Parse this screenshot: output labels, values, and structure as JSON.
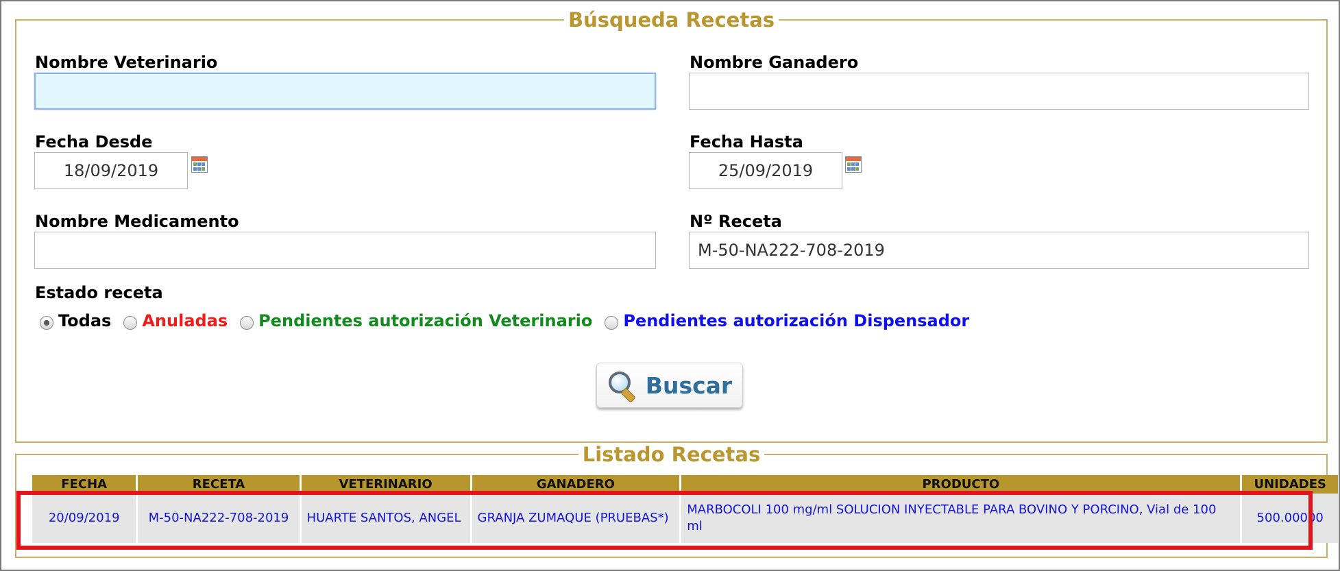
{
  "search": {
    "legend": "Búsqueda Recetas",
    "vet_label": "Nombre Veterinario",
    "vet_value": "",
    "ganadero_label": "Nombre Ganadero",
    "ganadero_value": "",
    "fecha_desde_label": "Fecha Desde",
    "fecha_desde_value": "18/09/2019",
    "fecha_hasta_label": "Fecha Hasta",
    "fecha_hasta_value": "25/09/2019",
    "medicamento_label": "Nombre Medicamento",
    "medicamento_value": "",
    "receta_label": "Nº Receta",
    "receta_value": "M-50-NA222-708-2019",
    "estado_label": "Estado receta",
    "estado_options": [
      "Todas",
      "Anuladas",
      "Pendientes autorización Veterinario",
      "Pendientes autorización Dispensador"
    ],
    "estado_selected": "Todas",
    "buscar_label": "Buscar",
    "icons": {
      "calendar": "calendar-icon",
      "search": "magnifier-icon"
    }
  },
  "listado": {
    "legend": "Listado Recetas",
    "columns": [
      "FECHA",
      "RECETA",
      "VETERINARIO",
      "GANADERO",
      "PRODUCTO",
      "UNIDADES"
    ],
    "rows": [
      {
        "fecha": "20/09/2019",
        "receta": "M-50-NA222-708-2019",
        "veterinario": "HUARTE SANTOS, ANGEL",
        "ganadero": "GRANJA ZUMAQUE (PRUEBAS*)",
        "producto": "MARBOCOLI 100 mg/ml SOLUCION INYECTABLE PARA BOVINO Y PORCINO, Vial de 100 ml",
        "unidades": "500.00000"
      }
    ]
  },
  "colors": {
    "legend": "#b9972e",
    "header_bg": "#b8962e",
    "anuladas": "#f01b1b",
    "pend_vet": "#138a1d",
    "pend_disp": "#1010ee",
    "highlight": "#e3141c"
  }
}
